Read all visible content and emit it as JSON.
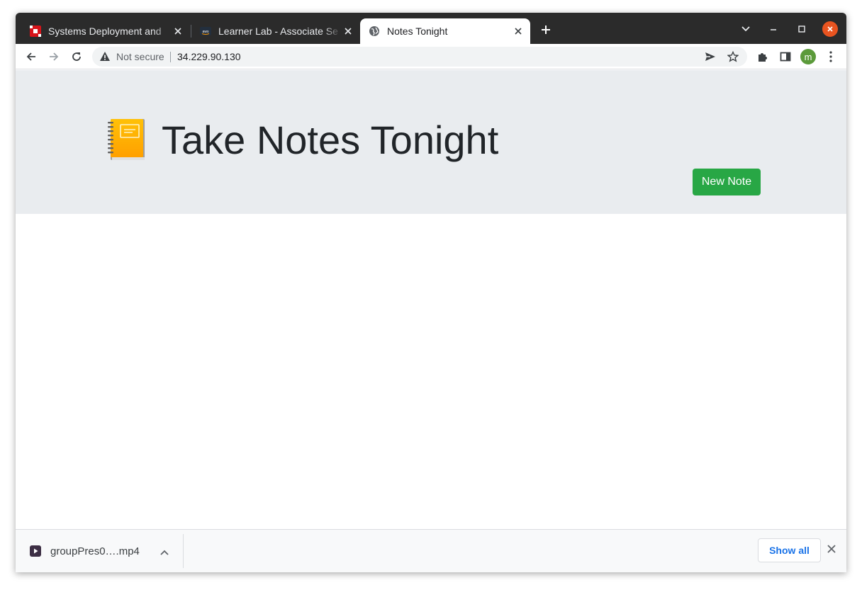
{
  "browser": {
    "tabs": [
      {
        "title": "Systems Deployment and",
        "favicon": "red-app-favicon-icon",
        "active": false
      },
      {
        "title": "Learner Lab - Associate Se",
        "favicon": "aws-favicon-icon",
        "active": false
      },
      {
        "title": "Notes Tonight",
        "favicon": "globe-favicon-icon",
        "active": true
      }
    ],
    "address_bar": {
      "security_label": "Not secure",
      "url": "34.229.90.130"
    },
    "profile_initial": "m"
  },
  "page": {
    "title": "Take Notes Tonight",
    "brand_icon": "notebook-icon",
    "new_note_label": "New Note"
  },
  "downloads": {
    "file_name": "groupPres0….mp4",
    "show_all_label": "Show all"
  },
  "colors": {
    "primary_button": "#28a745",
    "jumbotron_bg": "#e9ecef",
    "tabstrip_bg": "#2b2b2b",
    "close_window": "#e95420",
    "avatar": "#5b9a3a"
  }
}
